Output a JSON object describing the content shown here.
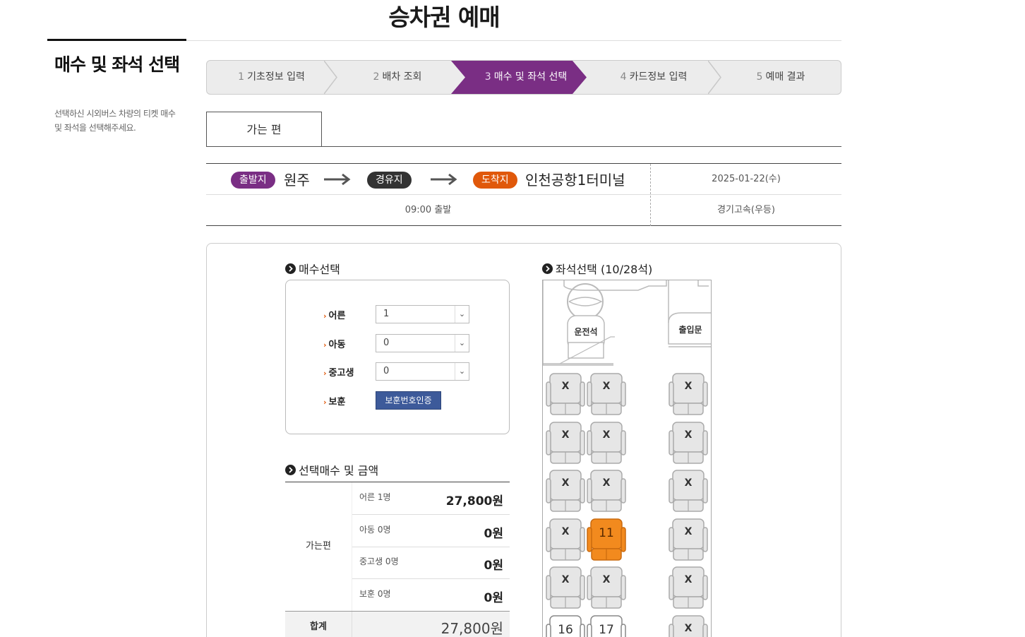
{
  "page": {
    "title": "승차권 예매"
  },
  "sidebar": {
    "heading": "매수 및 좌석 선택",
    "description": "선택하신 시외버스 차량의 티켓 매수 및 좌석을 선택해주세요."
  },
  "steps": [
    {
      "num": "1",
      "label": "기초정보 입력"
    },
    {
      "num": "2",
      "label": "배차 조회"
    },
    {
      "num": "3",
      "label": "매수 및 좌석 선택"
    },
    {
      "num": "4",
      "label": "카드정보 입력"
    },
    {
      "num": "5",
      "label": "예매 결과"
    }
  ],
  "active_step": 3,
  "tab": {
    "label": "가는 편"
  },
  "route": {
    "dep_badge": "출발지",
    "dep_place": "원주",
    "via_badge": "경유지",
    "arr_badge": "도착지",
    "arr_place": "인천공항1터미널",
    "date": "2025-01-22(수)",
    "time": "09:00 출발",
    "company": "경기고속(우등)"
  },
  "count_section": {
    "title": "매수선택",
    "rows": [
      {
        "label": "어른",
        "value": "1"
      },
      {
        "label": "아동",
        "value": "0"
      },
      {
        "label": "중고생",
        "value": "0"
      }
    ],
    "bohun_label": "보훈",
    "bohun_button": "보훈번호인증"
  },
  "price_section": {
    "title": "선택매수 및 금액",
    "group_label": "가는편",
    "rows": [
      {
        "label": "어른 1명",
        "value": "27,800원"
      },
      {
        "label": "아동 0명",
        "value": "0원"
      },
      {
        "label": "중고생 0명",
        "value": "0원"
      },
      {
        "label": "보훈 0명",
        "value": "0원"
      }
    ],
    "total_label": "합계",
    "total_value": "27,800원"
  },
  "seat_section": {
    "title": "좌석선택 (10/28석)",
    "driver_label": "운전석",
    "door_label": "출입문",
    "seats": [
      {
        "label": "X",
        "state": "sold"
      },
      {
        "label": "X",
        "state": "sold"
      },
      {
        "label": "X",
        "state": "sold"
      },
      {
        "label": "X",
        "state": "sold"
      },
      {
        "label": "X",
        "state": "sold"
      },
      {
        "label": "X",
        "state": "sold"
      },
      {
        "label": "X",
        "state": "sold"
      },
      {
        "label": "X",
        "state": "sold"
      },
      {
        "label": "X",
        "state": "sold"
      },
      {
        "label": "X",
        "state": "sold"
      },
      {
        "label": "11",
        "state": "selected"
      },
      {
        "label": "X",
        "state": "sold"
      },
      {
        "label": "X",
        "state": "sold"
      },
      {
        "label": "X",
        "state": "sold"
      },
      {
        "label": "X",
        "state": "sold"
      },
      {
        "label": "16",
        "state": "free"
      },
      {
        "label": "17",
        "state": "free"
      },
      {
        "label": "X",
        "state": "sold"
      }
    ]
  },
  "colors": {
    "accent": "#7a2e84",
    "arrival": "#e0580a",
    "selected_seat": "#f28a1e",
    "button": "#3d5a9a"
  }
}
